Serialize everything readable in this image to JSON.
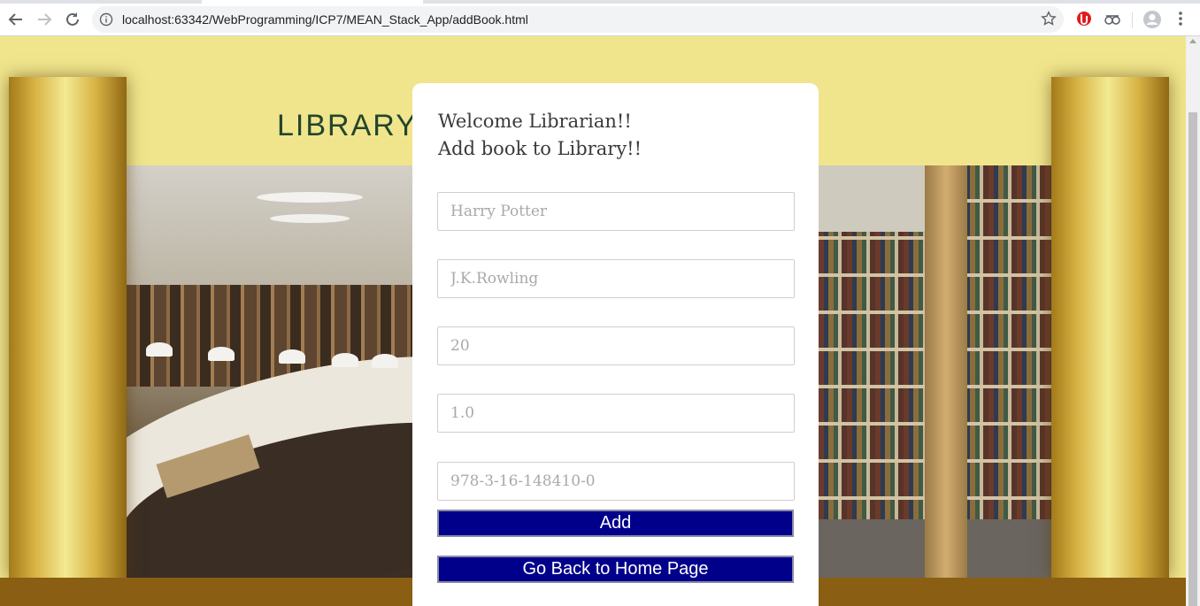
{
  "browser": {
    "url": "localhost:63342/WebProgramming/ICP7/MEAN_Stack_App/addBook.html",
    "icons": [
      "back-arrow-icon",
      "forward-arrow-icon",
      "reload-icon",
      "info-icon",
      "bookmark-star-icon",
      "extension-icon",
      "incognito-cloud-icon",
      "profile-icon",
      "menu-dots-icon"
    ]
  },
  "hero": {
    "title": "LIBRARY MANAGEMENT SYSTEM"
  },
  "form": {
    "heading_line1": "Welcome Librarian!!",
    "heading_line2": "Add book to Library!!",
    "fields": {
      "book_name_placeholder": "Harry Potter",
      "author_placeholder": "J.K.Rowling",
      "quantity_placeholder": "20",
      "edition_placeholder": "1.0",
      "isbn_placeholder": "978-3-16-148410-0"
    },
    "add_label": "Add",
    "home_label": "Go Back to Home Page"
  },
  "colors": {
    "button_bg": "#00008b",
    "page_bg": "#f0e58c",
    "gold": "#d7b243"
  }
}
